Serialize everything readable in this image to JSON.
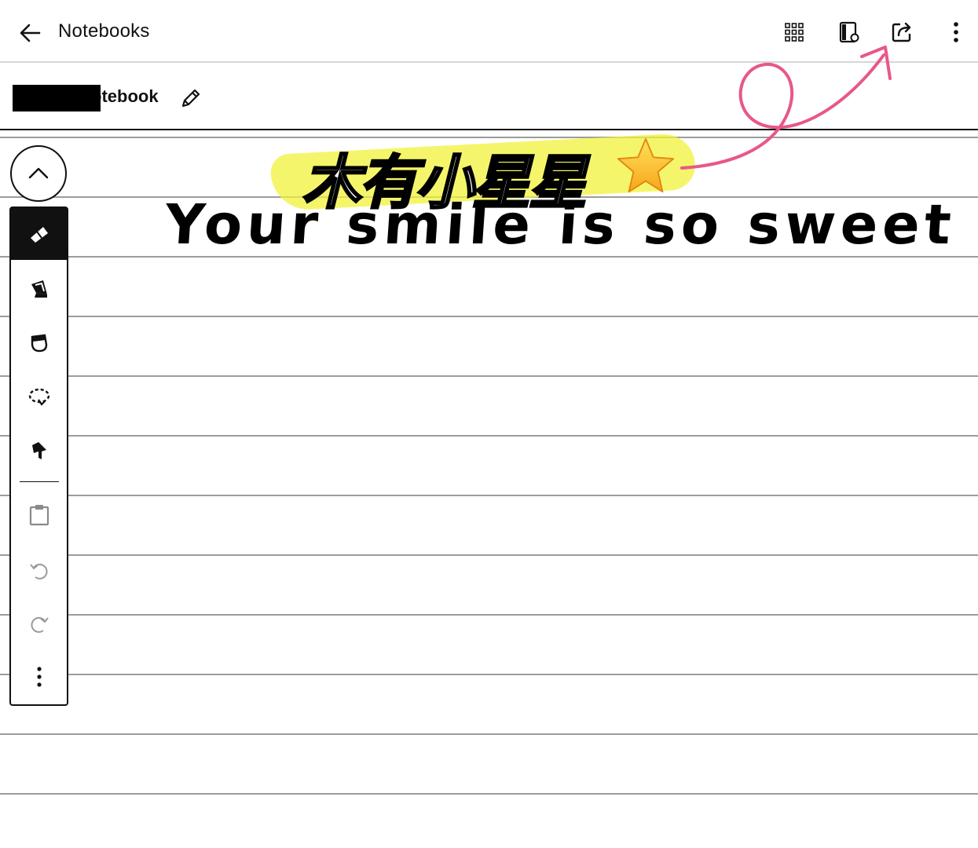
{
  "topbar": {
    "back_label": "Notebooks",
    "icons": [
      "back-arrow-icon",
      "grid-view-icon",
      "notebook-settings-icon",
      "share-icon",
      "more-vertical-icon"
    ]
  },
  "notebook": {
    "title_visible": "otebook"
  },
  "toolbar": {
    "tools": [
      "pen-icon",
      "highlighter-icon",
      "eraser-icon",
      "lasso-icon",
      "pointer-icon",
      "clipboard-icon",
      "undo-icon",
      "redo-icon",
      "more-icon"
    ],
    "active_tool": "pen-icon"
  },
  "canvas": {
    "handwritten_text": "Your smile is so sweet",
    "sticker_text": "木有小星星",
    "sticker_emoji": "star-emoji",
    "highlight_color": "#f2f13a",
    "arrow_color": "#e8578a"
  }
}
